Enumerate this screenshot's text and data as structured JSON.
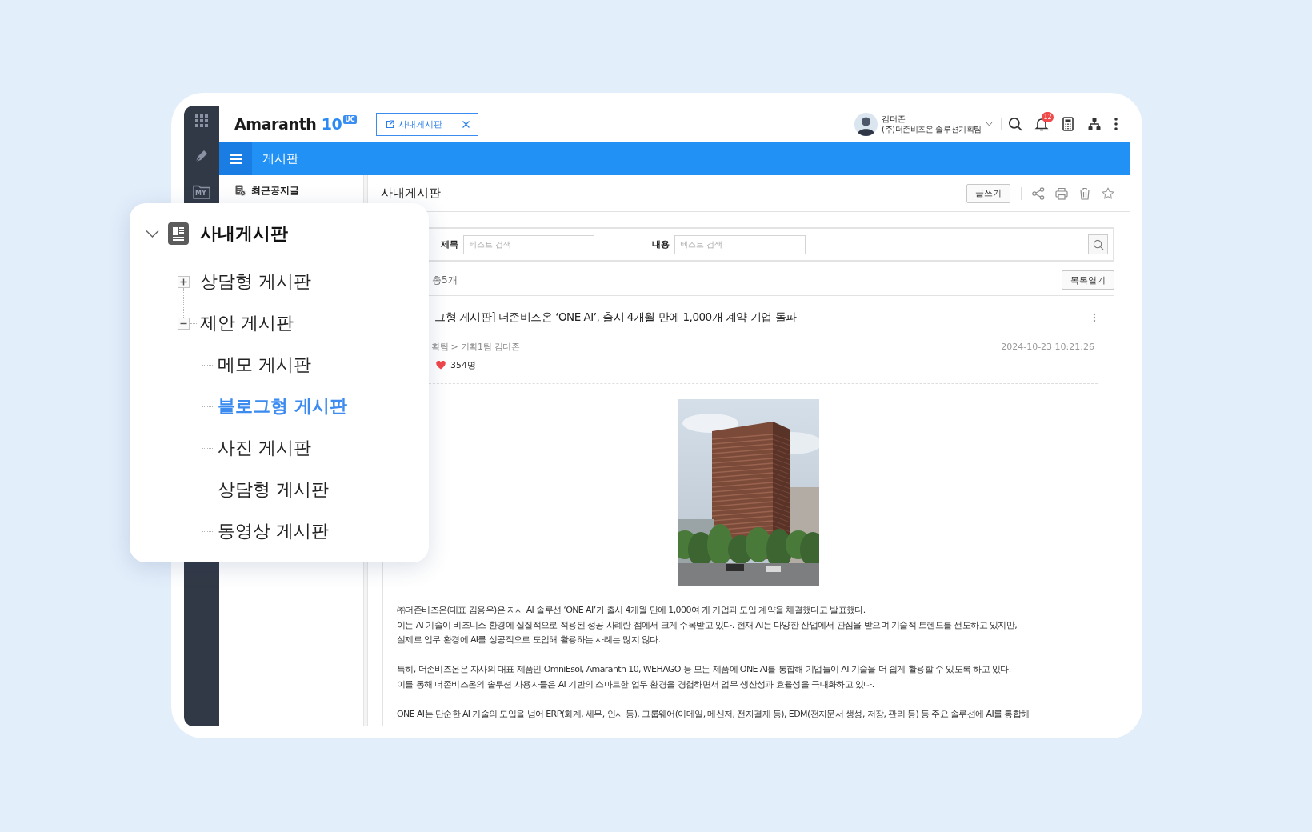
{
  "rail": {
    "folder_label": "MY"
  },
  "header": {
    "logo": {
      "wordmark": "Amaranth",
      "version": "10",
      "badge": "UC"
    },
    "open_tab": {
      "label": "사내게시판"
    },
    "user": {
      "name": "김더존",
      "department": "(주)더존비즈온 솔루션기획팀"
    },
    "notification_count": "12"
  },
  "menu_bar": {
    "title": "게시판"
  },
  "sidebar": {
    "items": [
      {
        "label": "최근공지글"
      }
    ]
  },
  "board": {
    "title": "사내게시판",
    "write_button": "글쓰기",
    "search": {
      "fields": [
        {
          "label": "제목",
          "placeholder": "텍스트 검색"
        },
        {
          "label": "내용",
          "placeholder": "텍스트 검색"
        }
      ]
    },
    "post_count": "총5개",
    "list_button": "목록열기",
    "post": {
      "title": "그형 게시판] 더존비즈온 ‘ONE AI’, 출시 4개월 만에 1,000개 계약 기업 돌파",
      "author_path": "획팀 > 기획1팀 김더존",
      "date": "2024-10-23 10:21:26",
      "likes": "354명",
      "paragraphs": [
        [
          "㈜더존비즈온(대표 김용우)은 자사 AI 솔루션 ‘ONE AI’가 출시 4개월 만에 1,000여 개 기업과 도입 계약을 체결했다고 발표했다.",
          "이는 AI 기술이 비즈니스 환경에 실질적으로 적용된 성공 사례란 점에서 크게 주목받고 있다. 현재 AI는 다양한 산업에서 관심을 받으며 기술적 트렌드를 선도하고 있지만,",
          "실제로 업무 환경에 AI를 성공적으로 도입해 활용하는 사례는 많지 않다."
        ],
        [
          "특히, 더존비즈온은 자사의 대표 제품인 OmniEsol, Amaranth 10, WEHAGO 등 모든 제품에 ONE AI를 통합해 기업들이 AI 기술을 더 쉽게 활용할 수 있도록 하고 있다.",
          "이를 통해 더존비즈온의 솔루션 사용자들은 AI 기반의 스마트한 업무 환경을 경험하면서 업무 생산성과 효율성을 극대화하고 있다."
        ],
        [
          "ONE AI는 단순한 AI 기술의 도입을 넘어 ERP(회계, 세무, 인사 등), 그룹웨어(이메일, 메신저, 전자결재 등), EDM(전자문서 생성, 저장, 관리 등) 등 주요 솔루션에 AI를 통합해"
        ]
      ]
    }
  },
  "tree_popup": {
    "title": "사내게시판",
    "expanded": true,
    "selected": false,
    "children": [
      {
        "label": "상담형 게시판",
        "expanded": false,
        "selected": false
      },
      {
        "label": "제안 게시판",
        "expanded": true,
        "selected": false,
        "children": [
          {
            "label": "메모 게시판",
            "selected": false
          },
          {
            "label": "블로그형 게시판",
            "selected": true
          },
          {
            "label": "사진 게시판",
            "selected": false
          },
          {
            "label": "상담형 게시판",
            "selected": false
          },
          {
            "label": "동영상 게시판",
            "selected": false
          }
        ]
      }
    ]
  }
}
